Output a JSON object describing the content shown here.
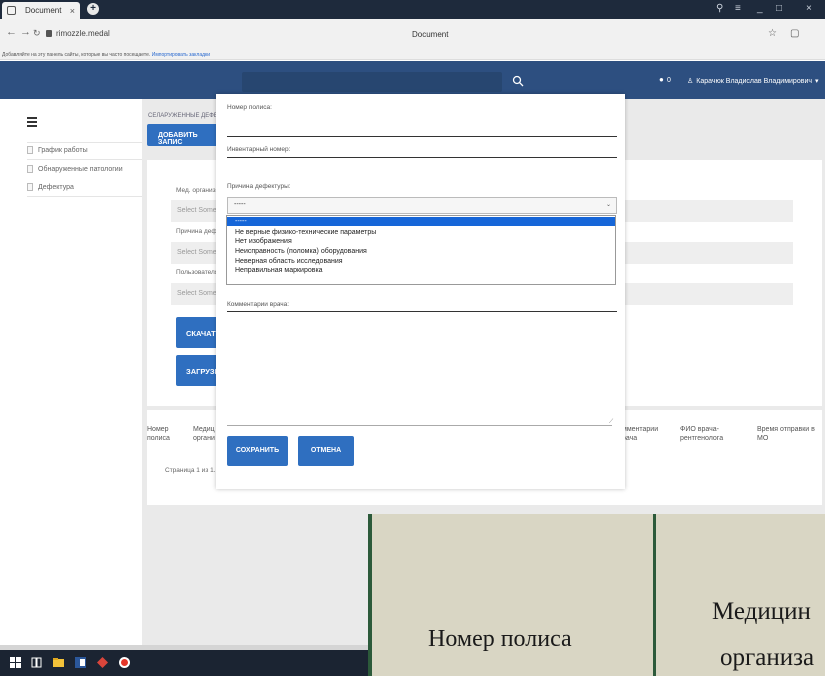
{
  "browser": {
    "tab_title": "Document",
    "tab_close": "×",
    "new_tab": "+",
    "url": "rimozzle.medal",
    "page_title": "Document",
    "win_controls": [
      "⚲",
      "≡",
      "_",
      "□",
      "×"
    ],
    "bookmarks_hint": "Добавляйте на эту панель сайты, которые вы часто посещаете.",
    "bookmarks_link": "Импортировать закладки"
  },
  "navbar": {
    "bell_count": "0",
    "user_name": "Карачюк Владислав Владимирович",
    "user_caret": "▾"
  },
  "sidebar": {
    "items": [
      {
        "label": "График работы"
      },
      {
        "label": "Обнаруженные патологии"
      },
      {
        "label": "Дефектура"
      }
    ]
  },
  "main": {
    "breadcrumb": "СЕЛАРУЖЕННЫЕ ДЕФЕК",
    "add_button": "ДОБАВИТЬ ЗАПИС",
    "filters": [
      {
        "label": "Мед. организа",
        "placeholder": "Select Some"
      },
      {
        "label": "Причина дефе",
        "placeholder": "Select Some"
      },
      {
        "label": "Пользователя",
        "placeholder": "Select Some"
      }
    ],
    "download_button": "СКАЧАТЬ",
    "upload_button": "ЗАГРУЗИ",
    "table_headers": [
      "Номер\nполиса",
      "Медиц\nоргани",
      "мментарии\nрача",
      "ФИО врача-\nрентгенолога",
      "Время отправки в\nМО"
    ],
    "pagination": "Страница 1 из 1."
  },
  "modal": {
    "policy_label": "Номер полиса:",
    "inventory_label": "Инвентарный номер:",
    "reason_label": "Причина дефектуры:",
    "reason_selected": "-----",
    "reason_options": [
      "-----",
      "Не верные физико-технические параметры",
      "Нет изображения",
      "Неисправность (поломка) оборудования",
      "Неверная область исследования",
      "Неправильная маркировка"
    ],
    "comment_label": "Комментарии врача:",
    "save_button": "СОХРАНИТЬ",
    "cancel_button": "ОТМЕНА"
  },
  "zoom_overlay": {
    "left_text": "Номер полиса",
    "right_text_line1": "Медицин",
    "right_text_line2": "организа"
  },
  "colors": {
    "navbar": "#2d4f80",
    "primary_button": "#2f6fc0",
    "option_highlight": "#1666d8",
    "zoom_bg": "#d9d6c4",
    "zoom_border": "#2c5a3a"
  }
}
